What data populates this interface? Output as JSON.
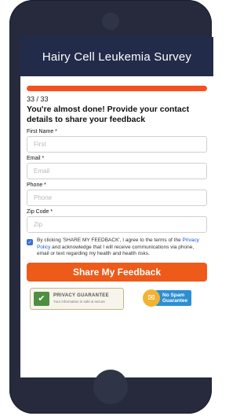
{
  "header": {
    "title": "Hairy Cell Leukemia Survey"
  },
  "progress": {
    "text": "33 / 33",
    "fraction": 1.0
  },
  "heading": "You're almost done! Provide your contact details to share your feedback",
  "fields": [
    {
      "label": "First Name *",
      "placeholder": "First"
    },
    {
      "label": "Email *",
      "placeholder": "Email"
    },
    {
      "label": "Phone *",
      "placeholder": "Phone"
    },
    {
      "label": "Zip Code *",
      "placeholder": "Zip"
    }
  ],
  "consent": {
    "checked": true,
    "text_before": "By clicking 'SHARE MY FEEDBACK', I agree to the terms of the ",
    "link": "Privacy Policy",
    "text_after": " and acknowledge that I will receive communications via phone, email or text regarding my health and health risks."
  },
  "cta": {
    "label": "Share My Feedback"
  },
  "badges": {
    "privacy_title": "PRIVACY GUARANTEE",
    "privacy_sub": "Your information is safe & secure",
    "spam_line1": "No Spam",
    "spam_line2": "Guarantee"
  },
  "colors": {
    "header_bg": "#232b4a",
    "accent": "#ee5a1a",
    "link": "#1a57d6",
    "phone_body": "#262a3c"
  }
}
